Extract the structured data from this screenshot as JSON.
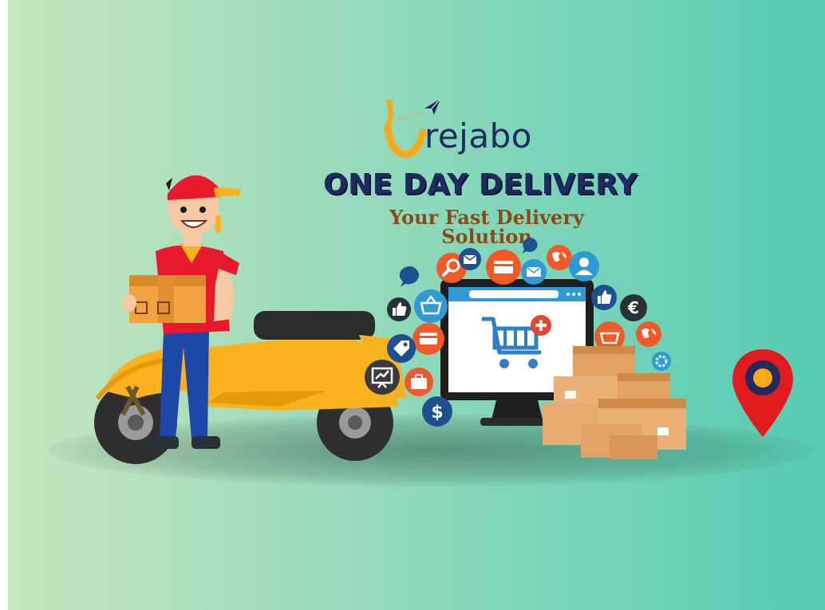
{
  "brand": {
    "name": "rejabo"
  },
  "headline": "ONE DAY DELIVERY",
  "subheadline": "Your Fast Delivery Solution",
  "colors": {
    "background_left": "#c6e6be",
    "background_right": "#55cbb1",
    "headline": "#1f2a5e",
    "subheadline": "#8a4a12",
    "scooter": "#fbb21f",
    "shirt": "#e8192c",
    "pin": "#e11b1b"
  },
  "icons": [
    "paper-plane-icon",
    "chat-bubble-icon",
    "search-icon",
    "credit-card-icon",
    "mail-icon",
    "globe-icon",
    "user-icon",
    "thumbs-up-icon",
    "euro-icon",
    "shopping-basket-icon",
    "tag-icon",
    "presentation-icon",
    "briefcase-icon",
    "dollar-icon",
    "gear-icon",
    "shopping-cart-icon",
    "location-pin-icon"
  ]
}
